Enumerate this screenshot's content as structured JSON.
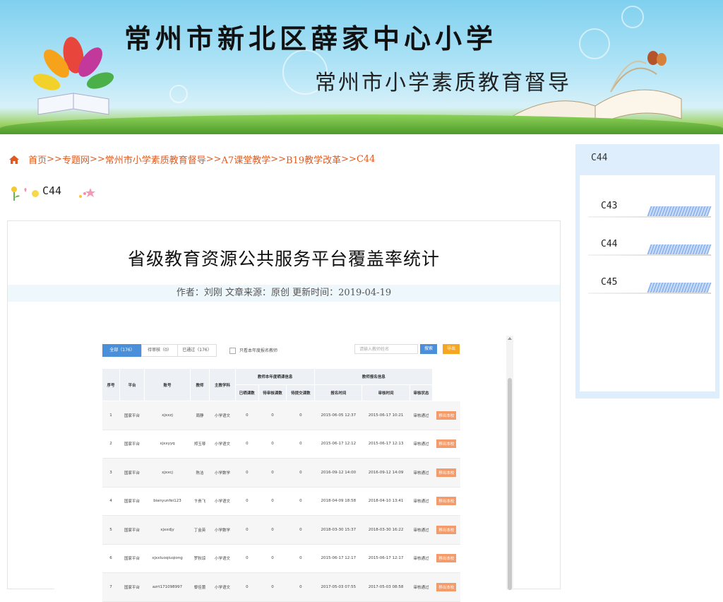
{
  "banner": {
    "school_name": "常州市新北区薛家中心小学",
    "subtitle": "常州市小学素质教育督导"
  },
  "breadcrumb": {
    "items": [
      "首页",
      "专题网",
      "常州市小学素质教育督导",
      "A7课堂教学",
      "B19教学改革",
      "C44"
    ],
    "separator": ">>"
  },
  "section_title": "C44",
  "article": {
    "title": "省级教育资源公共服务平台覆盖率统计",
    "meta": "作者：刘刚  文章来源：原创  更新时间：2019-04-19"
  },
  "embedded_screenshot": {
    "tabs": [
      {
        "label": "全部（176）",
        "active": true
      },
      {
        "label": "待审核（0）",
        "active": false
      },
      {
        "label": "已通过（176）",
        "active": false
      }
    ],
    "checkbox_label": "只看本年度报名教师",
    "search_placeholder": "请输入教师姓名",
    "search_button": "搜索",
    "export_button": "导出",
    "headers_top": [
      "序号",
      "平台",
      "账号",
      "教师",
      "主教学科",
      "教师本年度晒课信息",
      "教师报名信息"
    ],
    "headers_sub": [
      "已晒课数",
      "待审核课数",
      "待提交课数",
      "报名时间",
      "审核时间",
      "审核状态"
    ],
    "rows": [
      [
        "1",
        "国家平台",
        "xjxxzj",
        "周静",
        "小学语文",
        "0",
        "0",
        "0",
        "2015-06-05 12:37",
        "2015-06-17 10:21",
        "审核通过",
        "移出本校"
      ],
      [
        "2",
        "国家平台",
        "xjxxyyq",
        "郑玉琴",
        "小学语文",
        "0",
        "0",
        "0",
        "2015-06-17 12:12",
        "2015-06-17 12:13",
        "审核通过",
        "移出本校"
      ],
      [
        "3",
        "国家平台",
        "xjxxcj",
        "陈洁",
        "小学数学",
        "0",
        "0",
        "0",
        "2016-09-12 14:00",
        "2016-09-12 14:09",
        "审核通过",
        "移出本校"
      ],
      [
        "4",
        "国家平台",
        "bianyunfei123",
        "卞贵飞",
        "小学语文",
        "0",
        "0",
        "0",
        "2018-04-09 18:58",
        "2018-04-10 13:41",
        "审核通过",
        "移出本校"
      ],
      [
        "5",
        "国家平台",
        "xjxxdjy",
        "丁金英",
        "小学数学",
        "0",
        "0",
        "0",
        "2018-03-30 15:37",
        "2018-03-30 16:22",
        "审核通过",
        "移出本校"
      ],
      [
        "6",
        "国家平台",
        "xjxxluoqiuqiong",
        "罗秋琼",
        "小学语文",
        "0",
        "0",
        "0",
        "2015-06-17 12:17",
        "2015-06-17 12:17",
        "审核通过",
        "移出本校"
      ],
      [
        "7",
        "国家平台",
        "azrt171098997",
        "黎佳蕾",
        "小学语文",
        "0",
        "0",
        "0",
        "2017-05-03 07:55",
        "2017-05-03 08:58",
        "审核通过",
        "移出本校"
      ]
    ]
  },
  "sidebar": {
    "heading": "C44",
    "items": [
      "C43",
      "C44",
      "C45"
    ]
  },
  "colors": {
    "link": "#e05a1e",
    "sidebar_bg": "#dfeefd",
    "meta_bg": "#eef8fc",
    "tab_active": "#4a8fd9",
    "export_button": "#f5a623",
    "remove_button": "#f39b6b"
  }
}
